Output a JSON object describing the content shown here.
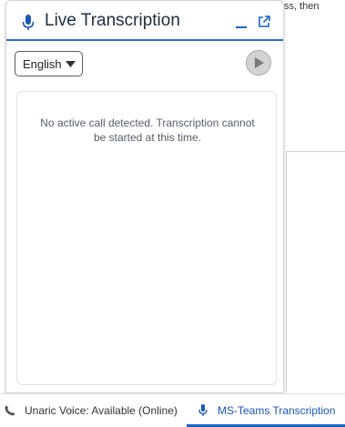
{
  "background": {
    "partial_text": "ss, then"
  },
  "panel": {
    "title": "Live Transcription",
    "icons": {
      "title": "microphone-icon",
      "minimize": "minimize-icon",
      "popout": "popout-icon",
      "play": "play-icon",
      "caret": "chevron-down-icon"
    },
    "language": {
      "selected": "English"
    },
    "status_message": "No active call detected. Transcription cannot be started at this time."
  },
  "utility_bar": {
    "items": [
      {
        "label": "Unaric Voice: Available (Online)",
        "icon": "phone-icon",
        "active": false
      },
      {
        "label": "MS-Teams Transcription",
        "icon": "microphone-icon",
        "active": true
      }
    ]
  },
  "colors": {
    "accent": "#2b6bc2",
    "active_tab": "#1b63c9",
    "title_text": "#1f2d3d",
    "muted_text": "#555e69"
  }
}
